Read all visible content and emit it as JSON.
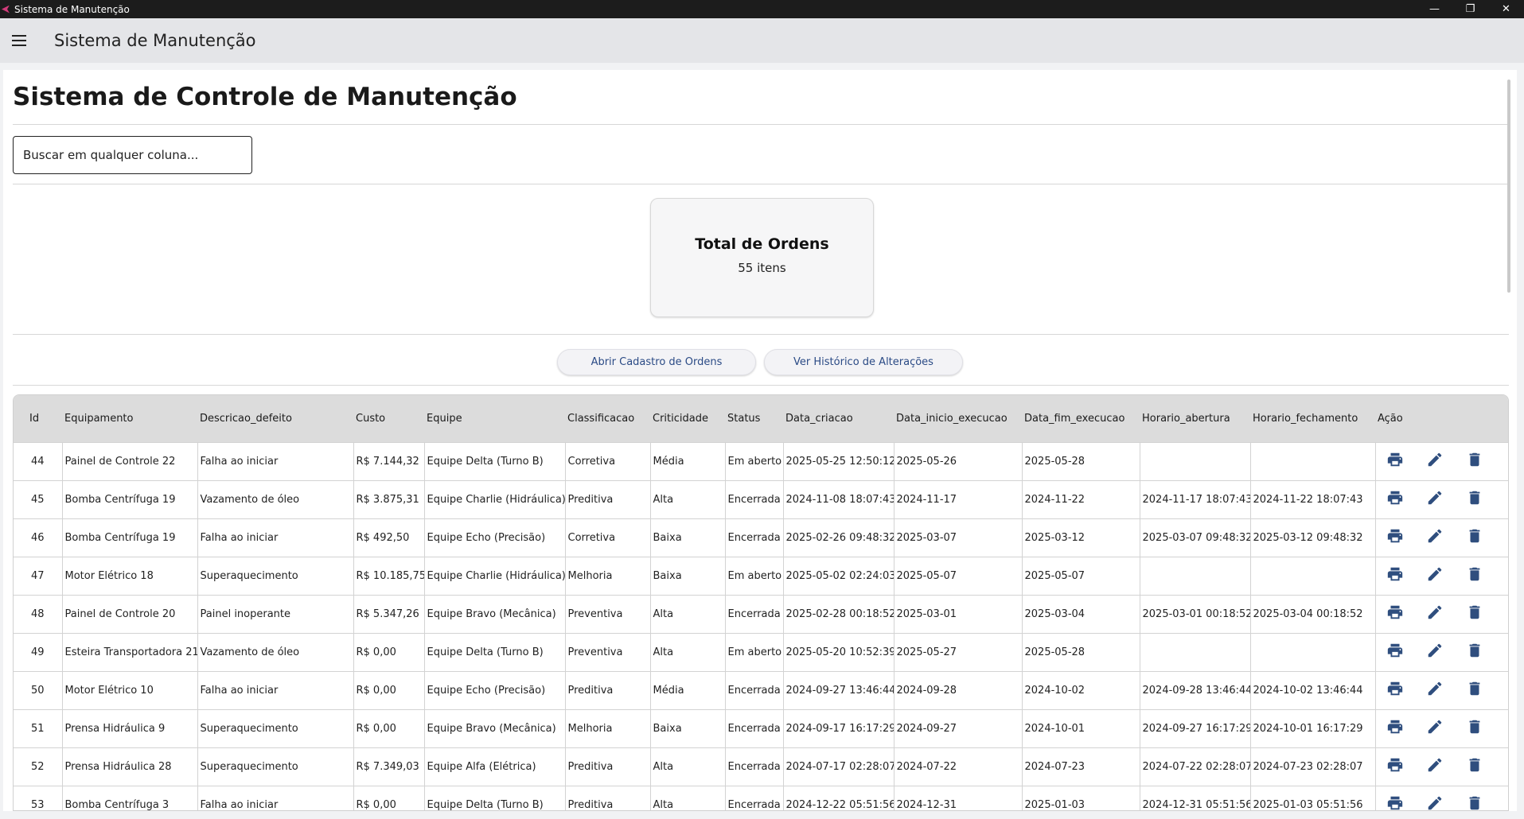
{
  "window": {
    "title": "Sistema de Manutenção",
    "minimize": "—",
    "restore": "❐",
    "close": "✕"
  },
  "appbar": {
    "title": "Sistema de Manutenção"
  },
  "page": {
    "title": "Sistema de Controle de Manutenção"
  },
  "search": {
    "placeholder": "Buscar em qualquer coluna..."
  },
  "summary": {
    "title": "Total de Ordens",
    "value": "55 itens"
  },
  "buttons": {
    "open_register": "Abrir Cadastro de Ordens",
    "history": "Ver Histórico de Alterações"
  },
  "table": {
    "columns": [
      "Id",
      "Equipamento",
      "Descricao_defeito",
      "Custo",
      "Equipe",
      "Classificacao",
      "Criticidade",
      "Status",
      "Data_criacao",
      "Data_inicio_execucao",
      "Data_fim_execucao",
      "Horario_abertura",
      "Horario_fechamento",
      "Ação"
    ],
    "rows": [
      [
        "44",
        "Painel de Controle 22",
        "Falha ao iniciar",
        "R$ 7.144,32",
        "Equipe Delta (Turno B)",
        "Corretiva",
        "Média",
        "Em aberto",
        "2025-05-25 12:50:12",
        "2025-05-26",
        "2025-05-28",
        "",
        ""
      ],
      [
        "45",
        "Bomba Centrífuga 19",
        "Vazamento de óleo",
        "R$ 3.875,31",
        "Equipe Charlie (Hidráulica)",
        "Preditiva",
        "Alta",
        "Encerrada",
        "2024-11-08 18:07:43",
        "2024-11-17",
        "2024-11-22",
        "2024-11-17 18:07:43",
        "2024-11-22 18:07:43"
      ],
      [
        "46",
        "Bomba Centrífuga 19",
        "Falha ao iniciar",
        "R$ 492,50",
        "Equipe Echo (Precisão)",
        "Corretiva",
        "Baixa",
        "Encerrada",
        "2025-02-26 09:48:32",
        "2025-03-07",
        "2025-03-12",
        "2025-03-07 09:48:32",
        "2025-03-12 09:48:32"
      ],
      [
        "47",
        "Motor Elétrico 18",
        "Superaquecimento",
        "R$ 10.185,75",
        "Equipe Charlie (Hidráulica)",
        "Melhoria",
        "Baixa",
        "Em aberto",
        "2025-05-02 02:24:03",
        "2025-05-07",
        "2025-05-07",
        "",
        ""
      ],
      [
        "48",
        "Painel de Controle 20",
        "Painel inoperante",
        "R$ 5.347,26",
        "Equipe Bravo (Mecânica)",
        "Preventiva",
        "Alta",
        "Encerrada",
        "2025-02-28 00:18:52",
        "2025-03-01",
        "2025-03-04",
        "2025-03-01 00:18:52",
        "2025-03-04 00:18:52"
      ],
      [
        "49",
        "Esteira Transportadora 21",
        "Vazamento de óleo",
        "R$ 0,00",
        "Equipe Delta (Turno B)",
        "Preventiva",
        "Alta",
        "Em aberto",
        "2025-05-20 10:52:39",
        "2025-05-27",
        "2025-05-28",
        "",
        ""
      ],
      [
        "50",
        "Motor Elétrico 10",
        "Falha ao iniciar",
        "R$ 0,00",
        "Equipe Echo (Precisão)",
        "Preditiva",
        "Média",
        "Encerrada",
        "2024-09-27 13:46:44",
        "2024-09-28",
        "2024-10-02",
        "2024-09-28 13:46:44",
        "2024-10-02 13:46:44"
      ],
      [
        "51",
        "Prensa Hidráulica 9",
        "Superaquecimento",
        "R$ 0,00",
        "Equipe Bravo (Mecânica)",
        "Melhoria",
        "Baixa",
        "Encerrada",
        "2024-09-17 16:17:29",
        "2024-09-27",
        "2024-10-01",
        "2024-09-27 16:17:29",
        "2024-10-01 16:17:29"
      ],
      [
        "52",
        "Prensa Hidráulica 28",
        "Superaquecimento",
        "R$ 7.349,03",
        "Equipe Alfa (Elétrica)",
        "Preditiva",
        "Alta",
        "Encerrada",
        "2024-07-17 02:28:07",
        "2024-07-22",
        "2024-07-23",
        "2024-07-22 02:28:07",
        "2024-07-23 02:28:07"
      ],
      [
        "53",
        "Bomba Centrífuga 3",
        "Falha ao iniciar",
        "R$ 0,00",
        "Equipe Delta (Turno B)",
        "Preditiva",
        "Alta",
        "Encerrada",
        "2024-12-22 05:51:56",
        "2024-12-31",
        "2025-01-03",
        "2024-12-31 05:51:56",
        "2025-01-03 05:51:56"
      ]
    ],
    "actions": [
      {
        "icon": "printer-icon",
        "name": "print-button"
      },
      {
        "icon": "pencil-icon",
        "name": "edit-button"
      },
      {
        "icon": "trash-icon",
        "name": "delete-button"
      }
    ]
  },
  "colors": {
    "accent": "#2f4e7e",
    "header_bg": "#dcdcdc",
    "appbar_bg": "#e4e5e8",
    "titlebar_bg": "#1c1c1c"
  }
}
